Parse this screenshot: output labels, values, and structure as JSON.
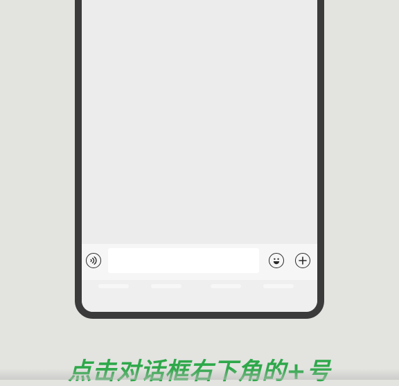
{
  "tutorial": {
    "caption": "点击对话框右下角的+号"
  },
  "chat": {
    "input": {
      "value": "",
      "placeholder": ""
    },
    "buttons": {
      "voice_icon": "voice-icon",
      "emoji_icon": "emoji-icon",
      "plus_icon": "plus-icon"
    }
  },
  "colors": {
    "caption": "#2ea84a",
    "phone_frame": "#3b3b3b",
    "background": "#e3e3e0",
    "chat_area": "#ececec"
  }
}
